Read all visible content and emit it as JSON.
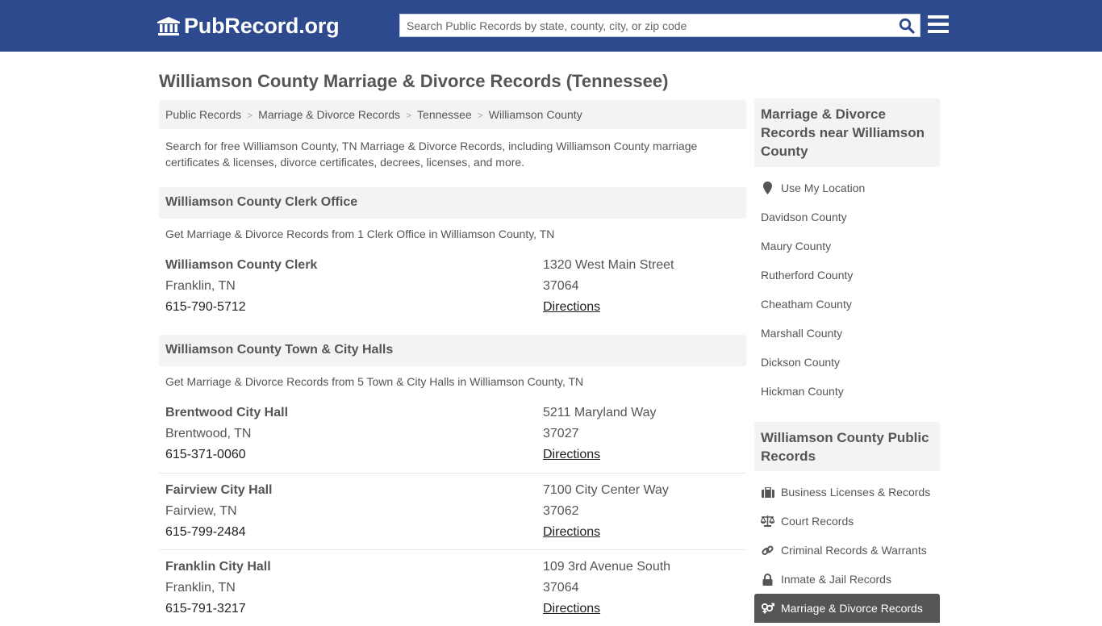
{
  "header": {
    "logo_text": "PubRecord.org",
    "search_placeholder": "Search Public Records by state, county, city, or zip code"
  },
  "page": {
    "title": "Williamson County Marriage & Divorce Records (Tennessee)",
    "breadcrumb": [
      "Public Records",
      "Marriage & Divorce Records",
      "Tennessee",
      "Williamson County"
    ],
    "intro": "Search for free Williamson County, TN Marriage & Divorce Records, including Williamson County marriage certificates & licenses, divorce certificates, decrees, licenses, and more."
  },
  "sections": [
    {
      "title": "Williamson County Clerk Office",
      "subtitle": "Get Marriage & Divorce Records from 1 Clerk Office in Williamson County, TN",
      "entries": [
        {
          "name": "Williamson County Clerk",
          "city": "Franklin, TN",
          "phone": "615-790-5712",
          "address": "1320 West Main Street",
          "zip": "37064",
          "directions": "Directions"
        }
      ]
    },
    {
      "title": "Williamson County Town & City Halls",
      "subtitle": "Get Marriage & Divorce Records from 5 Town & City Halls in Williamson County, TN",
      "entries": [
        {
          "name": "Brentwood City Hall",
          "city": "Brentwood, TN",
          "phone": "615-371-0060",
          "address": "5211 Maryland Way",
          "zip": "37027",
          "directions": "Directions"
        },
        {
          "name": "Fairview City Hall",
          "city": "Fairview, TN",
          "phone": "615-799-2484",
          "address": "7100 City Center Way",
          "zip": "37062",
          "directions": "Directions"
        },
        {
          "name": "Franklin City Hall",
          "city": "Franklin, TN",
          "phone": "615-791-3217",
          "address": "109 3rd Avenue South",
          "zip": "37064",
          "directions": "Directions"
        }
      ]
    }
  ],
  "sidebar": {
    "nearby_title": "Marriage & Divorce Records near Williamson County",
    "use_location": "Use My Location",
    "nearby": [
      "Davidson County",
      "Maury County",
      "Rutherford County",
      "Cheatham County",
      "Marshall County",
      "Dickson County",
      "Hickman County"
    ],
    "records_title": "Williamson County Public Records",
    "records": [
      {
        "label": "Business Licenses & Records",
        "icon": "briefcase-icon"
      },
      {
        "label": "Court Records",
        "icon": "scales-icon"
      },
      {
        "label": "Criminal Records & Warrants",
        "icon": "link-icon"
      },
      {
        "label": "Inmate & Jail Records",
        "icon": "lock-icon"
      },
      {
        "label": "Marriage & Divorce Records",
        "icon": "gender-icon",
        "active": true
      }
    ]
  },
  "colors": {
    "header_bg": "#2e4a8e",
    "search_icon": "#2e4a8e",
    "panel_bg": "#f3f3f3",
    "active_bg": "#555555"
  }
}
